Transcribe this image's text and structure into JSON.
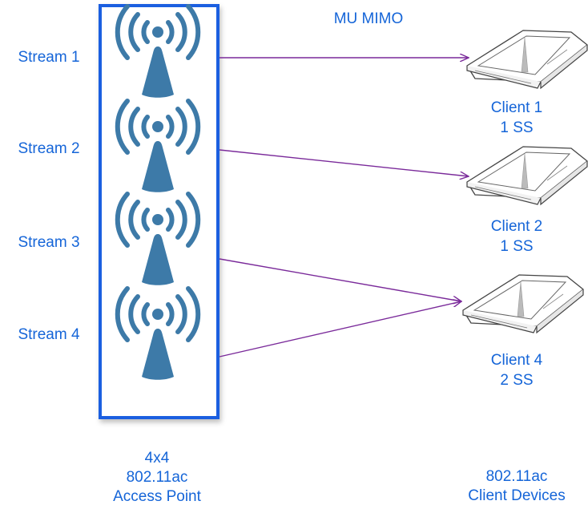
{
  "title": "MU MIMO",
  "colors": {
    "label": "#1565d8",
    "box_border": "#1b5fe0",
    "antenna": "#3d7aa8",
    "arrow": "#7a2a9a"
  },
  "streams": [
    {
      "label": "Stream 1",
      "icon": "antenna-icon"
    },
    {
      "label": "Stream 2",
      "icon": "antenna-icon"
    },
    {
      "label": "Stream 3",
      "icon": "antenna-icon"
    },
    {
      "label": "Stream 4",
      "icon": "antenna-icon"
    }
  ],
  "access_point": {
    "line1": "4x4",
    "line2": "802.11ac",
    "line3": "Access Point"
  },
  "clients": [
    {
      "name": "Client 1",
      "streams": "1 SS",
      "icon": "tablet-icon"
    },
    {
      "name": "Client 2",
      "streams": "1 SS",
      "icon": "tablet-icon"
    },
    {
      "name": "Client 4",
      "streams": "2 SS",
      "icon": "tablet-icon"
    }
  ],
  "connections": [
    {
      "from": "Stream 1",
      "to": "Client 1"
    },
    {
      "from": "Stream 2",
      "to": "Client 2"
    },
    {
      "from": "Stream 3",
      "to": "Client 4"
    },
    {
      "from": "Stream 4",
      "to": "Client 4"
    }
  ],
  "client_group": {
    "line1": "802.11ac",
    "line2": "Client Devices"
  }
}
